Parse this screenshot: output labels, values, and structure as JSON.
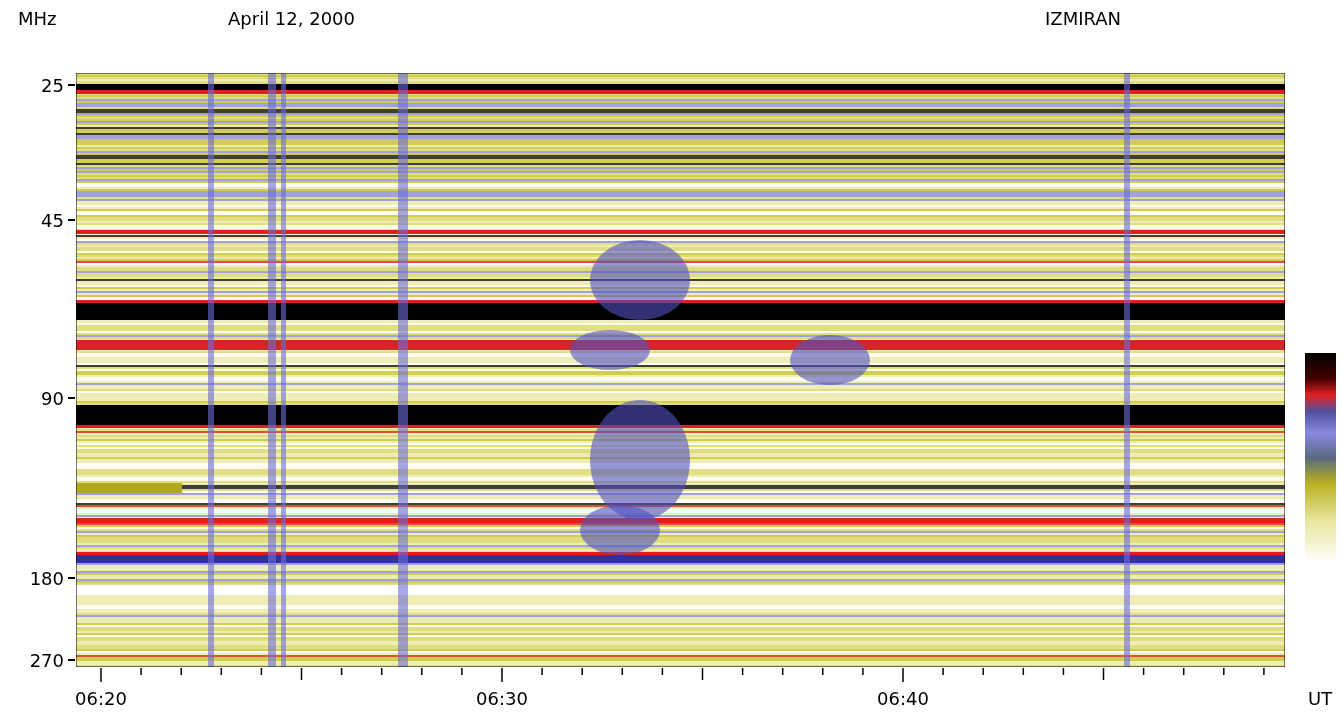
{
  "header": {
    "unit_label": "MHz",
    "date": "April 12, 2000",
    "station": "IZMIRAN"
  },
  "y_axis": {
    "ticks": [
      "25",
      "45",
      "90",
      "180",
      "270"
    ]
  },
  "x_axis": {
    "ticks": [
      "06:20",
      "06:30",
      "06:40"
    ],
    "unit": "UT"
  }
}
